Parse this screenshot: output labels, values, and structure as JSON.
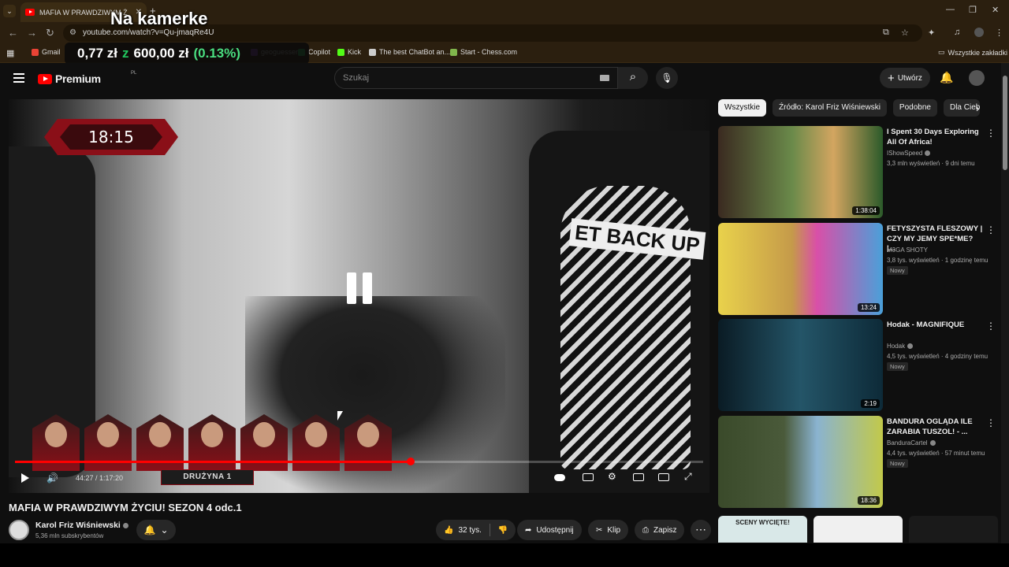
{
  "browser": {
    "tab_title": "MAFIA W PRAWDZIWYM Ż",
    "url": "youtube.com/watch?v=Qu-jmaqRe4U",
    "bookmarks": [
      {
        "label": "Gmail",
        "color": "#ea4335"
      },
      {
        "label": "",
        "color": "#ff0000"
      },
      {
        "label": "geoguesser",
        "color": "#7b3fa0"
      },
      {
        "label": "Copilot",
        "color": "#2ea44f"
      },
      {
        "label": "Kick",
        "color": "#53fc18"
      },
      {
        "label": "The best ChatBot an...",
        "color": "#cccccc"
      },
      {
        "label": "Start - Chess.com",
        "color": "#81b64c"
      }
    ],
    "all_bookmarks": "Wszystkie zakładki"
  },
  "overlay": {
    "title": "Na kamerke",
    "ticker_amount": "0,77 zł",
    "ticker_z": "z",
    "ticker_goal": "600,00 zł",
    "ticker_pct": "(0.13%)"
  },
  "header": {
    "logo": "Premium",
    "logo_sup": "PL",
    "search_placeholder": "Szukaj",
    "create": "Utwórz"
  },
  "player": {
    "timer": "18:15",
    "shirt_text": "ET BACK UP",
    "team": "DRUŻYNA 1",
    "time": "44:27 / 1:17:20",
    "progress": 0.575,
    "team_members": 7
  },
  "chips": [
    "Wszystkie",
    "Źródło: Karol Friz Wiśniewski",
    "Podobne",
    "Dla Ciebie"
  ],
  "recommendations": [
    {
      "title": "I Spent 30 Days Exploring All Of Africa!",
      "channel": "IShowSpeed",
      "meta": "3,3 mln wyświetleń · 9 dni temu",
      "badge": "",
      "duration": "1:38:04",
      "colors": [
        "#6a8a4a",
        "#d3a560",
        "#2b5a2a"
      ]
    },
    {
      "title": "FETYSZYSTA FLESZOWY | CZY MY JEMY SPE*ME? |...",
      "channel": "M3GA SHOTY",
      "meta": "3,8 tys. wyświetleń · 1 godzinę temu",
      "badge": "Nowy",
      "duration": "13:24",
      "colors": [
        "#e9d24b",
        "#d94fa8",
        "#4aa0d9"
      ]
    },
    {
      "title": "Hodak - MAGNIFIQUE",
      "channel": "Hodak",
      "meta": "4,5 tys. wyświetleń · 4 godziny temu",
      "badge": "Nowy",
      "duration": "2:19",
      "colors": [
        "#0d2a38",
        "#245568",
        "#0a1b24"
      ]
    },
    {
      "title": "BANDURA OGLĄDA ILE ZARABIA TUSZOL! - ...",
      "channel": "BanduraCartel",
      "meta": "4,4 tys. wyświetleń · 57 minut temu",
      "badge": "Nowy",
      "duration": "18:36",
      "colors": [
        "#3a4a2a",
        "#8ab3d0",
        "#c2c94a"
      ]
    }
  ],
  "video": {
    "title": "MAFIA W PRAWDZIWYM ŻYCIU! SEZON 4 odc.1",
    "channel": "Karol Friz Wiśniewski",
    "subs": "5,36 mln subskrybentów",
    "likes": "32 tys.",
    "share": "Udostępnij",
    "clip": "Klip",
    "save": "Zapisz"
  },
  "bottom_thumbs": [
    {
      "label": "SCENY WYCIĘTE!",
      "color": "#d9e8e8"
    },
    {
      "label": "",
      "color": "#f0f0f0"
    },
    {
      "label": "",
      "color": "#1a1a1a"
    }
  ]
}
